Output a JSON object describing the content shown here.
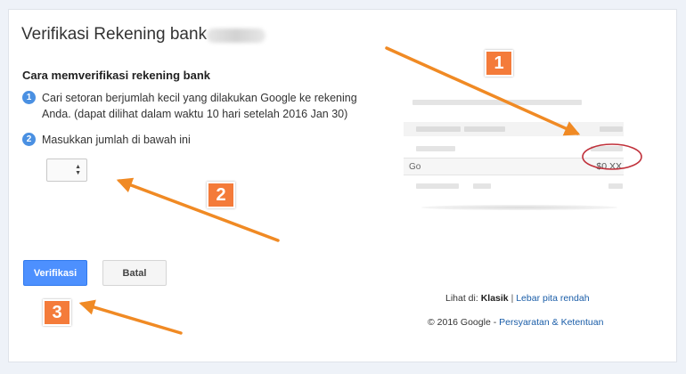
{
  "page": {
    "title": "Verifikasi Rekening bank",
    "heading": "Cara memverifikasi rekening bank"
  },
  "steps": [
    {
      "number": "1",
      "text": "Cari setoran berjumlah kecil yang dilakukan Google ke rekening Anda. (dapat dilihat dalam waktu 10 hari setelah 2016 Jan 30)"
    },
    {
      "number": "2",
      "text": "Masukkan jumlah di bawah ini"
    }
  ],
  "amount_input": {
    "value": ""
  },
  "buttons": {
    "verify": "Verifikasi",
    "cancel": "Batal"
  },
  "view_links": {
    "prefix": "Lihat di:",
    "classic": "Klasik",
    "separator": "|",
    "low_bandwidth": "Lebar pita rendah"
  },
  "footer": {
    "copyright": "© 2016 Google -",
    "terms": "Persyaratan & Ketentuan"
  },
  "statement_example": {
    "row_label": "Go",
    "amount": "$0.XX"
  },
  "annotations": [
    "1",
    "2",
    "3"
  ],
  "colors": {
    "primary_button": "#4d90fe",
    "annotation": "#f47b3a",
    "arrow": "#f08a24",
    "highlight_circle": "#c0303a",
    "link": "#1a5da8"
  }
}
